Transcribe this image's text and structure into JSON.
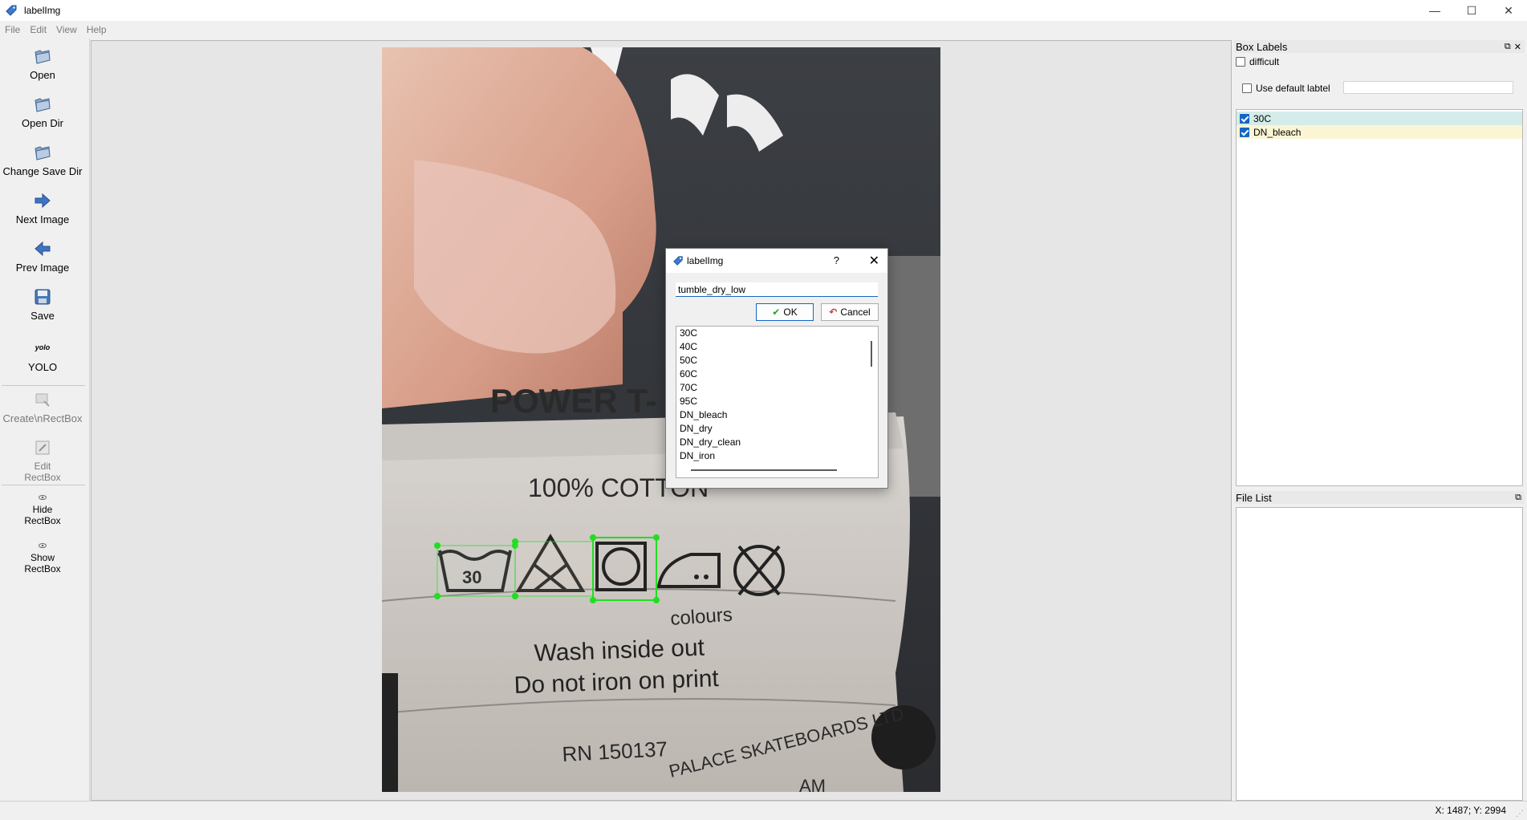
{
  "window": {
    "title": "labelImg",
    "controls": {
      "minimize": "—",
      "maximize": "☐",
      "close": "✕"
    }
  },
  "menu": [
    "File",
    "Edit",
    "View",
    "Help"
  ],
  "toolbar": {
    "open": "Open",
    "open_dir": "Open Dir",
    "change_save_dir": "Change Save Dir",
    "next_image": "Next Image",
    "prev_image": "Prev Image",
    "save": "Save",
    "yolo_icon_text": "yolo",
    "yolo": "YOLO",
    "create_rect": "Create\\nRectBox",
    "edit_rect_1": "Edit",
    "edit_rect_2": "RectBox",
    "hide_rect_1": "Hide",
    "hide_rect_2": "RectBox",
    "show_rect_1": "Show",
    "show_rect_2": "RectBox"
  },
  "box_labels_panel": {
    "title": "Box Labels",
    "difficult": "difficult",
    "difficult_checked": false,
    "use_default_label": "Use default labtel",
    "use_default_checked": false,
    "default_label_value": "",
    "labels": [
      {
        "name": "30C",
        "checked": true,
        "highlight": "#d4ecea"
      },
      {
        "name": "DN_bleach",
        "checked": true,
        "highlight": "#fbf5d4"
      }
    ]
  },
  "file_list_panel": {
    "title": "File List",
    "items": []
  },
  "status": {
    "coords": "X: 1487; Y: 2994"
  },
  "dialog": {
    "title": "labelImg",
    "help": "?",
    "close": "✕",
    "input_value": "tumble_dry_low",
    "ok_label": "OK",
    "cancel_label": "Cancel",
    "list_items": [
      "30C",
      "40C",
      "50C",
      "60C",
      "70C",
      "95C",
      "DN_bleach",
      "DN_dry",
      "DN_dry_clean",
      "DN_iron"
    ]
  },
  "photo": {
    "label_text": {
      "line1": "POWER T-",
      "line2": "100% COTTON",
      "line3": "colours",
      "line4": "Wash inside out",
      "line5": "Do not iron on print",
      "line6": "RN 150137",
      "line7": "PALACE SKATEBOARDS LTD",
      "line8": "AM",
      "wash_temp": "30"
    }
  },
  "colors": {
    "accent": "#1466c4",
    "bbox": "#22dd22",
    "row_30c": "#d4ecea",
    "row_bleach": "#fbf5d4"
  }
}
